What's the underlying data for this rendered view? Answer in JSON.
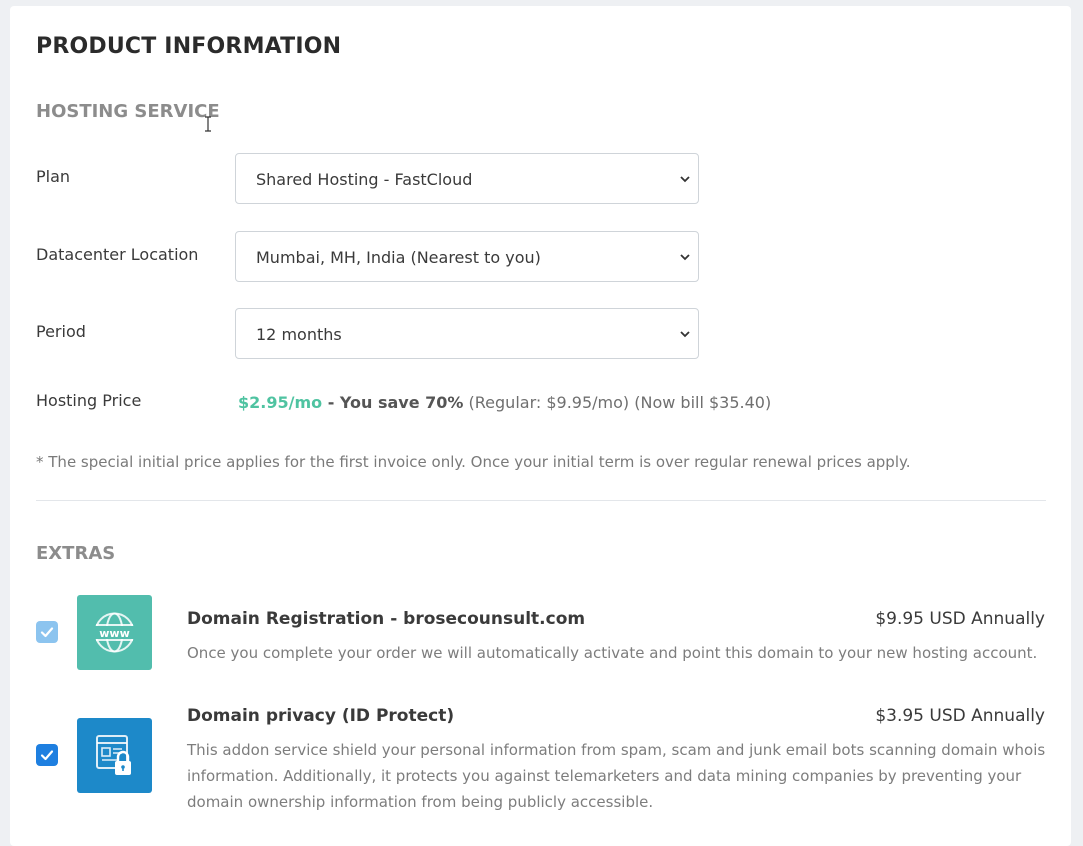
{
  "page": {
    "title": "PRODUCT INFORMATION"
  },
  "hosting": {
    "section_title": "HOSTING SERVICE",
    "plan": {
      "label": "Plan",
      "value": "Shared Hosting - FastCloud"
    },
    "datacenter": {
      "label": "Datacenter Location",
      "value": "Mumbai, MH, India (Nearest to you)"
    },
    "period": {
      "label": "Period",
      "value": "12 months"
    },
    "price": {
      "label": "Hosting Price",
      "amount": "$2.95/mo",
      "save": " - You save 70%",
      "details": " (Regular: $9.95/mo) (Now bill $35.40)"
    },
    "note": "* The special initial price applies for the first invoice only. Once your initial term is over regular renewal prices apply."
  },
  "extras": {
    "section_title": "EXTRAS",
    "items": [
      {
        "title": "Domain Registration - brosecounsult.com",
        "price": "$9.95 USD Annually",
        "description": "Once you complete your order we will automatically activate and point this domain to your new hosting account.",
        "checked": true,
        "checkbox_color": "#8cc4ef",
        "icon": "www-globe-icon",
        "icon_color": "#52bdad"
      },
      {
        "title": "Domain privacy (ID Protect)",
        "price": "$3.95 USD Annually",
        "description": "This addon service shield your personal information from spam, scam and junk email bots scanning domain whois information. Additionally, it protects you against telemarketers and data mining companies by preventing your domain ownership information from being publicly accessible.",
        "checked": true,
        "checkbox_color": "#1e7fe0",
        "icon": "id-lock-icon",
        "icon_color": "#1d89c9"
      }
    ]
  },
  "colors": {
    "accent_green": "#4fc3a1",
    "section_gray": "#8c8c8c"
  }
}
